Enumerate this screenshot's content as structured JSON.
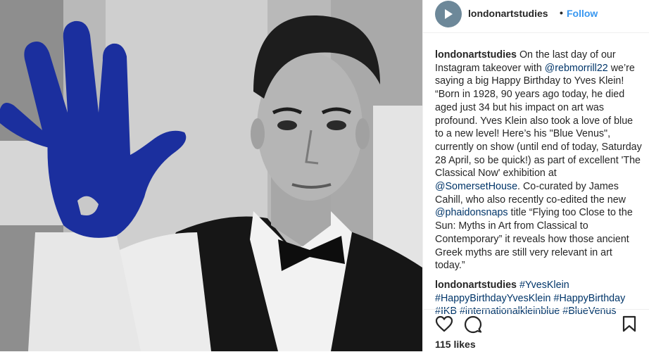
{
  "account": {
    "username": "londonartstudies",
    "separator": "•",
    "follow_label": "Follow",
    "avatar_icon": "play-arrow-icon"
  },
  "caption": {
    "username": "londonartstudies",
    "text_1": " On the last day of our Instagram takeover with ",
    "mention_1": "@rebmorrill22",
    "text_2": " we’re saying a big Happy Birthday to Yves Klein! “Born in 1928, 90 years ago today, he died aged just 34 but his impact on art was profound. Yves Klein also took a love of blue to a new level! Here’s his \"Blue Venus\", currently on show (until end of today, Saturday 28 April, so be quick!) as part of excellent 'The Classical Now' exhibition at ",
    "mention_2": "@SomersetHouse",
    "text_3": ". Co-curated by James Cahill, who also recently co-edited the new ",
    "mention_3": "@phaidonsnaps",
    "text_4": " title “Flying too Close to the Sun: Myths in Art from Classical to Contemporary” it reveals how those ancient Greek myths are still very relevant in art today.”"
  },
  "comment": {
    "username": "londonartstudies",
    "hashtags": [
      "#YvesKlein",
      "#HappyBirthdayYvesKlein",
      "#HappyBirthday",
      "#IKB",
      "#internationalkleinblue",
      "#BlueVenus"
    ]
  },
  "actions": {
    "like_icon": "heart-icon",
    "comment_icon": "comment-bubble-icon",
    "save_icon": "bookmark-icon",
    "likes_text": "115 likes"
  },
  "colors": {
    "link": "#003569",
    "follow": "#3897f0",
    "klein_blue": "#1b2f9e",
    "avatar": "#6d8899"
  }
}
